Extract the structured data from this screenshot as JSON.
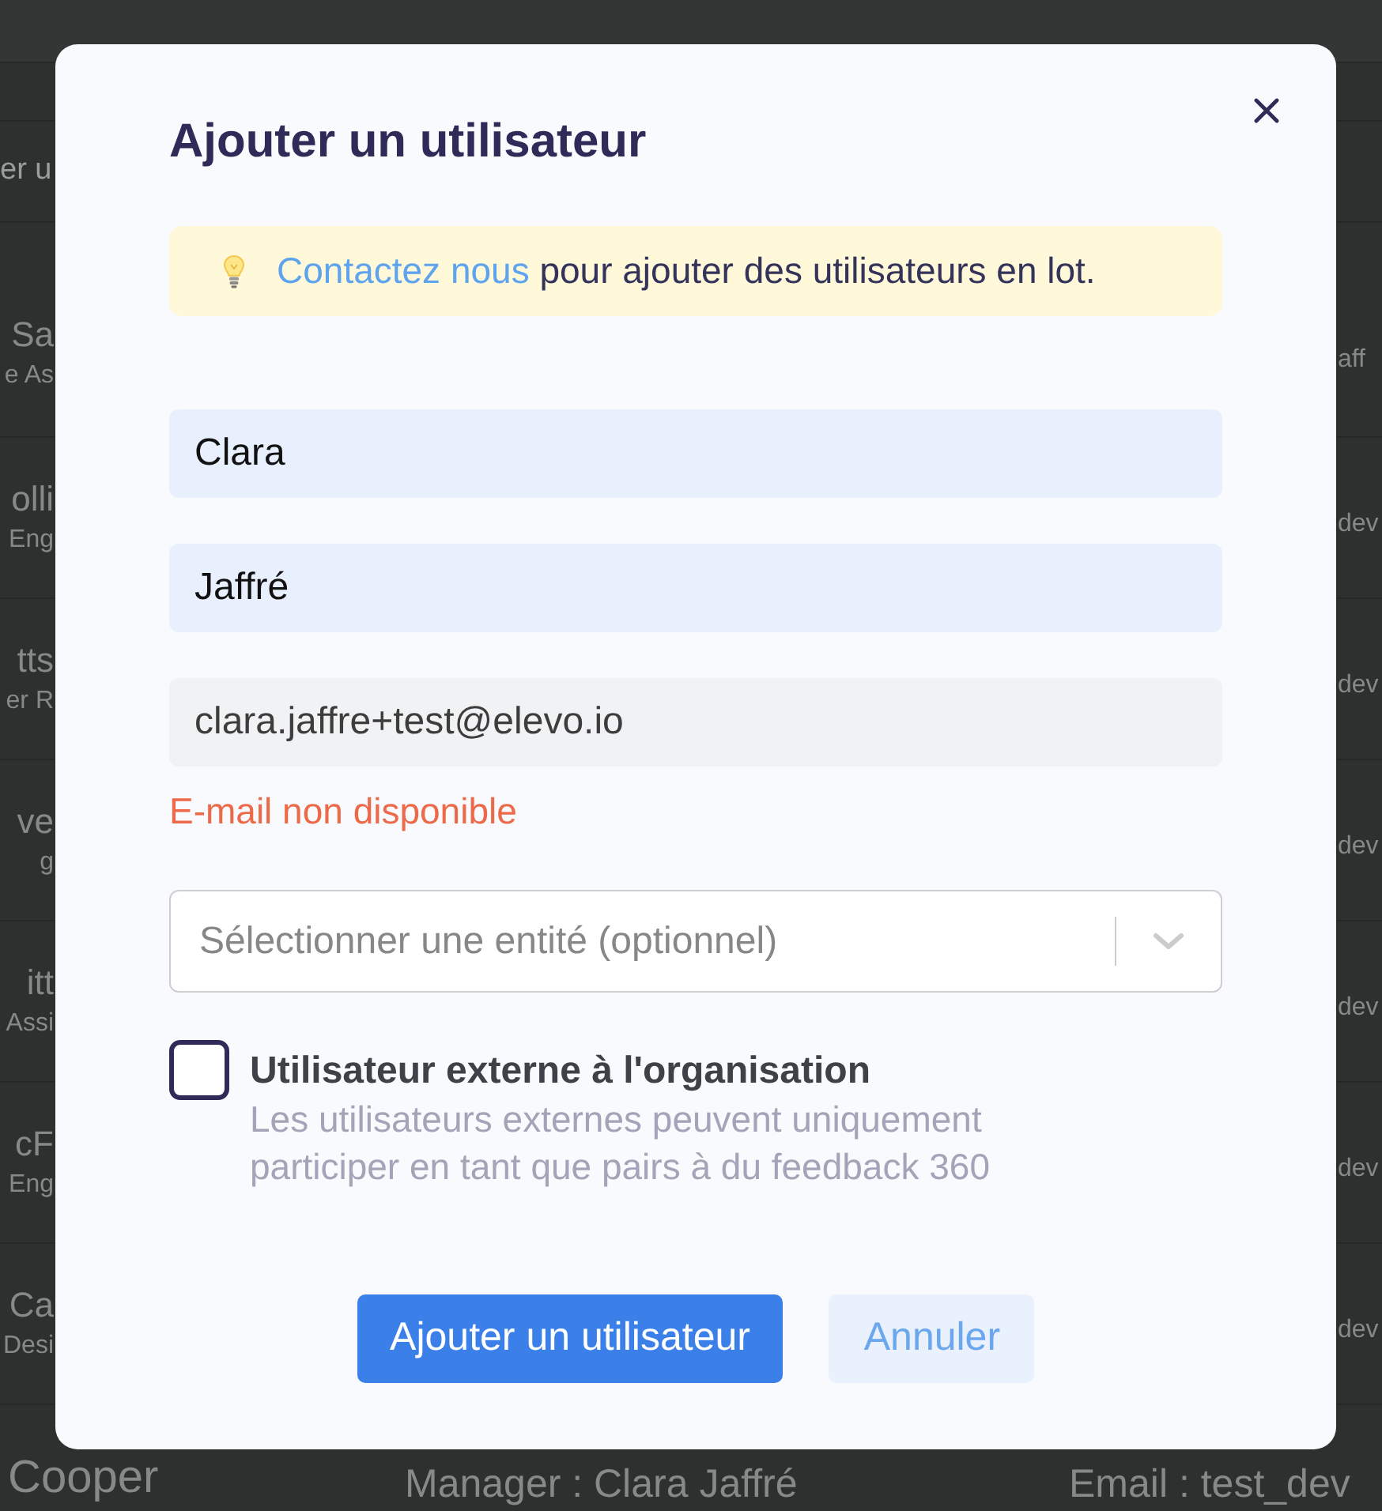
{
  "background": {
    "search": {
      "placeholder": "er u"
    },
    "rows": [
      {
        "name": "Sa",
        "subtitle": "e As",
        "email": "aff"
      },
      {
        "name": "olli",
        "subtitle": "Eng",
        "email": "dev"
      },
      {
        "name": "tts",
        "subtitle": "er R",
        "email": "dev"
      },
      {
        "name": "ve",
        "subtitle": "g",
        "email": "dev"
      },
      {
        "name": "itt",
        "subtitle": "Assi",
        "email": "dev"
      },
      {
        "name": "cF",
        "subtitle": "Eng",
        "email": "dev"
      },
      {
        "name": "Ca",
        "subtitle": "Desi",
        "email": "dev"
      }
    ],
    "bottom_row": {
      "name": "Cooper",
      "manager": "Manager : Clara Jaffré",
      "email": "Email : test_dev"
    }
  },
  "dialog": {
    "title": "Ajouter un utilisateur",
    "notice": {
      "link": "Contactez nous",
      "text": "pour ajouter des utilisateurs en lot."
    },
    "fields": [
      {
        "kind": "autofilled",
        "value": "Clara"
      },
      {
        "kind": "autofilled",
        "value": "Jaffré"
      },
      {
        "kind": "plain",
        "value": "clara.jaffre+test@elevo.io",
        "error": "E-mail non disponible"
      }
    ],
    "entity_select": {
      "placeholder": "Sélectionner une entité (optionnel)"
    },
    "external_option": {
      "label": "Utilisateur externe à l'organisation",
      "description": "Les utilisateurs externes peuvent uniquement participer en tant que pairs à du feedback 360",
      "checked": false
    },
    "buttons": [
      {
        "kind": "primary",
        "label": "Ajouter un utilisateur"
      },
      {
        "kind": "secondary",
        "label": "Annuler"
      }
    ]
  }
}
